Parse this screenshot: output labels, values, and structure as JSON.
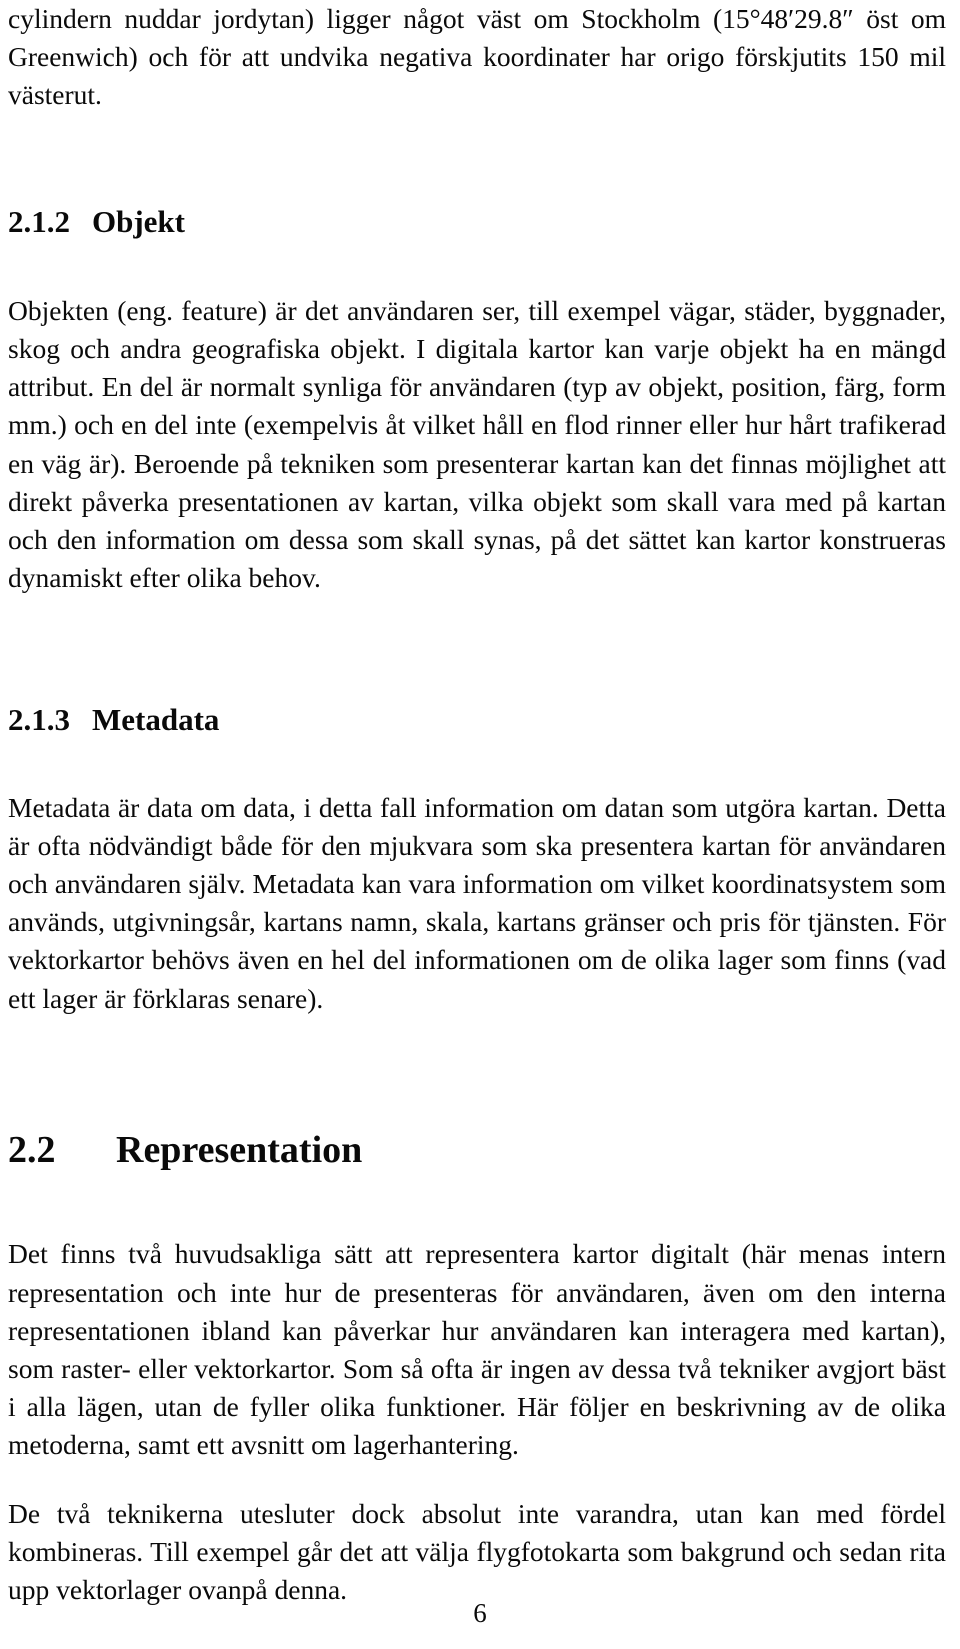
{
  "document": {
    "language": "sv",
    "page_number": "6",
    "text_color": "#0a0a0a",
    "background_color": "#ffffff"
  },
  "content": {
    "intro_paragraph_continued": "cylindern nuddar jordytan) ligger något väst om Stockholm (15°48′29.8″ öst om Greenwich) och för att undvika negativa koordinater har origo förskjutits 150 mil västerut.",
    "section_objekt": {
      "number": "2.1.2",
      "title": "Objekt",
      "paragraph": "Objekten (eng. feature) är det användaren ser, till exempel vägar, städer, byggnader, skog och andra geografiska objekt. I digitala kartor kan varje objekt ha en mängd attribut. En del är normalt synliga för användaren (typ av objekt, position, färg, form mm.) och en del inte (exempelvis åt vilket håll en flod rinner eller hur hårt trafikerad en väg är). Beroende på tekniken som presenterar kartan kan det finnas möjlighet att direkt påverka presentationen av kartan, vilka objekt som skall vara med på kartan och den information om dessa som skall synas, på det sättet kan kartor konstrueras dynamiskt efter olika behov."
    },
    "section_metadata": {
      "number": "2.1.3",
      "title": "Metadata",
      "paragraph": "Metadata är data om data, i detta fall information om datan som utgöra kartan. Detta är ofta nödvändigt både för den mjukvara som ska presentera kartan för användaren och användaren själv. Metadata kan vara information om vilket koordinatsystem som används, utgivningsår, kartans namn, skala, kartans gränser och pris för tjänsten. För vektorkartor behövs även en hel del informationen om de olika lager som finns (vad ett lager är förklaras senare)."
    },
    "section_representation": {
      "number": "2.2",
      "title": "Representation",
      "paragraph_1": "Det finns två huvudsakliga sätt att representera kartor digitalt (här menas intern representation och inte hur de presenteras för användaren, även om den interna representationen ibland kan påverkar hur användaren kan interagera med kartan), som raster- eller vektorkartor. Som så ofta är ingen av dessa två tekniker avgjort bäst i alla lägen, utan de fyller olika funktioner. Här följer en beskrivning av de olika metoderna, samt ett avsnitt om lagerhantering.",
      "paragraph_2": "De två teknikerna utesluter dock absolut inte varandra, utan kan med fördel kombineras. Till exempel går det att välja flygfotokarta som bakgrund och sedan rita upp vektorlager ovanpå denna."
    }
  }
}
